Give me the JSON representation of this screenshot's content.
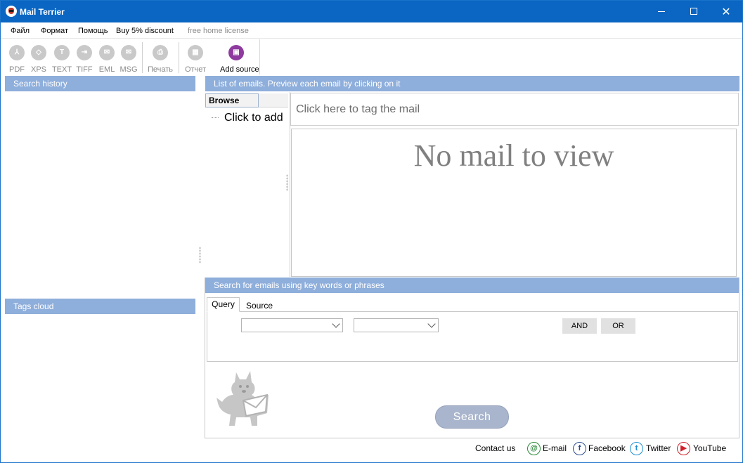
{
  "window": {
    "title": "Mail Terrier"
  },
  "menu": {
    "items": [
      "Файл",
      "Формат",
      "Помощь",
      "Buy 5% discount"
    ],
    "license": "free home license"
  },
  "toolbar": {
    "buttons": [
      {
        "label": "PDF",
        "icon": "pdf-icon"
      },
      {
        "label": "XPS",
        "icon": "xps-icon"
      },
      {
        "label": "TEXT",
        "icon": "text-icon"
      },
      {
        "label": "TIFF",
        "icon": "tiff-icon"
      },
      {
        "label": "EML",
        "icon": "eml-icon"
      },
      {
        "label": "MSG",
        "icon": "msg-icon"
      },
      {
        "label": "Печать",
        "icon": "print-icon"
      },
      {
        "label": "Отчет",
        "icon": "report-icon"
      },
      {
        "label": "Add source",
        "icon": "add-source-icon"
      }
    ]
  },
  "left": {
    "search_history": "Search history",
    "tags_cloud": "Tags cloud"
  },
  "list": {
    "header": "List of emails. Preview each email by clicking on it",
    "browse_tab": "Browse",
    "click_to_add": "Click to add",
    "tag_placeholder": "Click here to tag the mail",
    "no_mail": "No mail to view"
  },
  "search": {
    "header": "Search for emails using key words or phrases",
    "tabs": [
      "Query",
      "Source"
    ],
    "combo1_value": "",
    "combo2_value": "",
    "and_label": "AND",
    "or_label": "OR",
    "search_button": "Search"
  },
  "footer": {
    "contact": "Contact us",
    "email": "E-mail",
    "facebook": "Facebook",
    "twitter": "Twitter",
    "youtube": "YouTube"
  },
  "colors": {
    "titlebar": "#0a66c2",
    "panel_header": "#8eaedb",
    "accent_add_source": "#8e3a9e",
    "search_button": "#a9b5cc"
  }
}
